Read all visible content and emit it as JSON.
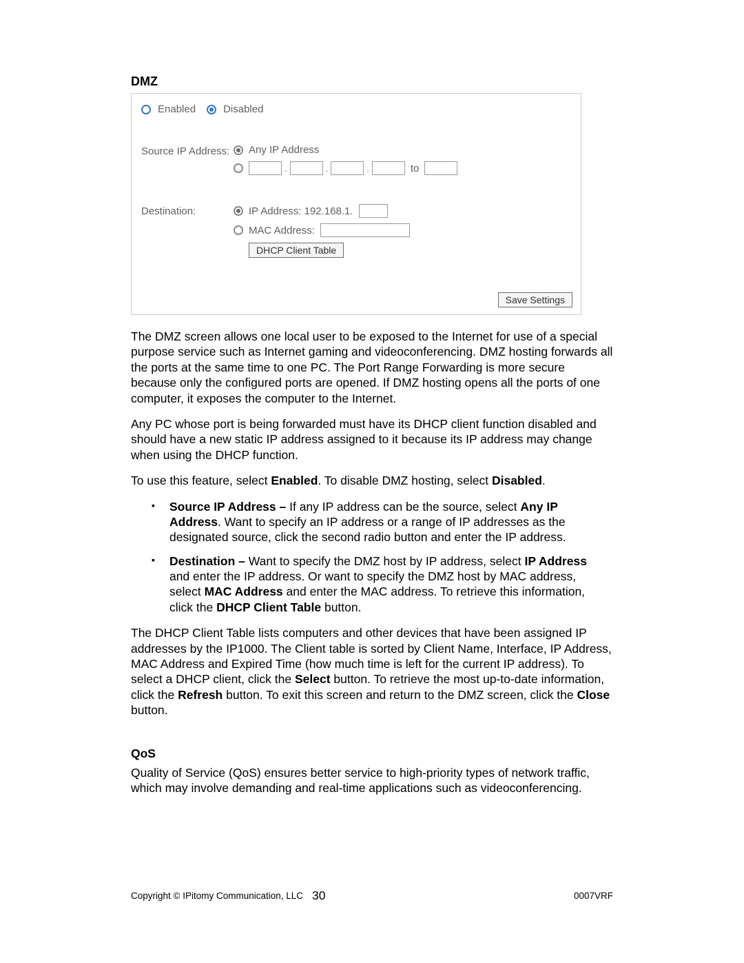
{
  "dmz": {
    "heading": "DMZ",
    "enable_label": "Enabled",
    "disable_label": "Disabled",
    "source_label": "Source IP Address:",
    "source_any_label": "Any IP Address",
    "source_to": "to",
    "dest_label": "Destination:",
    "dest_ip_label": "IP Address: 192.168.1.",
    "dest_mac_label": "MAC Address:",
    "dhcp_btn": "DHCP Client Table",
    "save_btn": "Save Settings"
  },
  "text": {
    "p1": "The DMZ screen allows one local user to be exposed to the Internet for use of a special purpose service such as Internet gaming and videoconferencing. DMZ hosting forwards all the ports at the same time to one PC. The Port Range Forwarding is more secure because only the configured ports are opened. If DMZ hosting opens all the ports of one computer, it exposes the computer to the Internet.",
    "p2": "Any PC whose port is being forwarded must have its DHCP client function disabled and should have a new static IP address assigned to it because its IP address may change when using the DHCP function.",
    "p3_a": "To use this feature, select ",
    "p3_enabled": "Enabled",
    "p3_b": ". To disable DMZ hosting, select ",
    "p3_disabled": "Disabled",
    "p3_c": ".",
    "b1_title": "Source IP Address – ",
    "b1_a": "If any IP address can be the source, select ",
    "b1_any": "Any IP Address",
    "b1_b": ". Want to specify an IP address or a range of IP addresses as the designated source, click the second radio button and enter the IP address.",
    "b2_title": "Destination – ",
    "b2_a": "Want to specify the DMZ host by IP address, select ",
    "b2_ip": "IP Address",
    "b2_b": " and enter the IP address. Or want to specify the DMZ host by MAC address, select ",
    "b2_mac": "MAC Address",
    "b2_c": " and enter the MAC address. To retrieve this information, click the ",
    "b2_dhcp": "DHCP Client Table",
    "b2_d": " button.",
    "p4_a": "The DHCP Client Table lists computers and other devices that have been assigned IP addresses by the IP1000. The Client table is sorted by Client Name, Interface, IP Address, MAC Address and Expired Time (how much time is left for the current IP address). To select a DHCP client, click the ",
    "p4_select": "Select",
    "p4_b": " button. To retrieve the most up-to-date information, click the ",
    "p4_refresh": "Refresh",
    "p4_c": " button. To exit this screen and return to the DMZ screen, click the ",
    "p4_close": "Close",
    "p4_d": " button.",
    "qos_heading": "QoS",
    "qos_p": "Quality of Service (QoS) ensures better service to high-priority types of network traffic, which may involve demanding and real-time applications such as videoconferencing."
  },
  "footer": {
    "left": "Copyright © IPitomy Communication, LLC",
    "center": "30",
    "right": "0007VRF"
  }
}
